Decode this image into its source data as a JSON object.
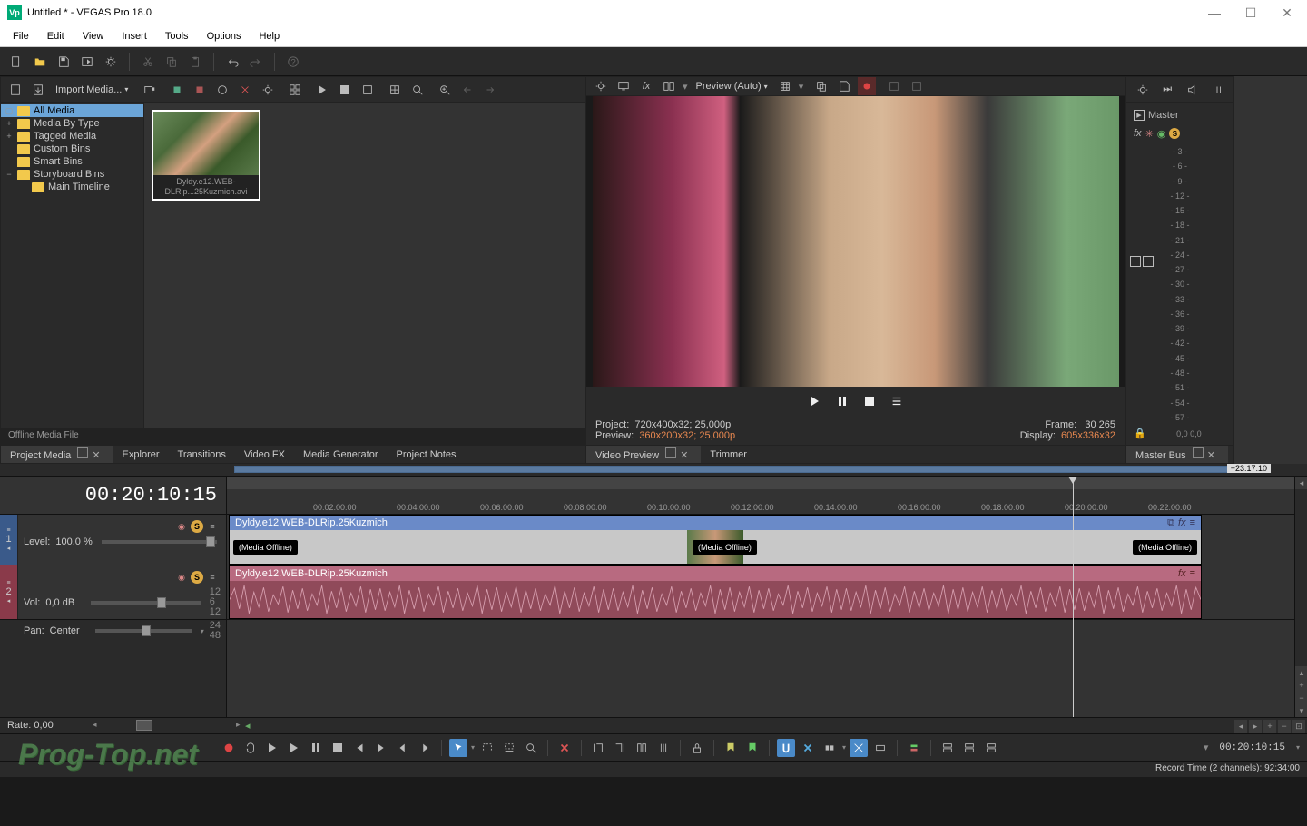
{
  "title": "Untitled * - VEGAS Pro 18.0",
  "menu": [
    "File",
    "Edit",
    "View",
    "Insert",
    "Tools",
    "Options",
    "Help"
  ],
  "projectMedia": {
    "importLabel": "Import Media...",
    "tree": [
      {
        "label": "All Media",
        "selected": true,
        "expand": "▢",
        "indent": 0
      },
      {
        "label": "Media By Type",
        "expand": "+",
        "indent": 0
      },
      {
        "label": "Tagged Media",
        "expand": "+",
        "indent": 0
      },
      {
        "label": "Custom Bins",
        "expand": "",
        "indent": 0
      },
      {
        "label": "Smart Bins",
        "expand": "",
        "indent": 0
      },
      {
        "label": "Storyboard Bins",
        "expand": "−",
        "indent": 0
      },
      {
        "label": "Main Timeline",
        "expand": "",
        "indent": 1
      }
    ],
    "thumbCaption": "Dyldy.e12.WEB-DLRip...25Kuzmich.avi",
    "status": "Offline Media File",
    "tabs": [
      "Project Media",
      "Explorer",
      "Transitions",
      "Video FX",
      "Media Generator",
      "Project Notes"
    ]
  },
  "preview": {
    "modeLabel": "Preview (Auto)",
    "projectLabel": "Project:",
    "projectValue": "720x400x32; 25,000p",
    "previewLabel": "Preview:",
    "previewValue": "360x200x32; 25,000p",
    "frameLabel": "Frame:",
    "frameValue": "30 265",
    "displayLabel": "Display:",
    "displayValue": "605x336x32",
    "tabs": [
      "Video Preview",
      "Trimmer"
    ]
  },
  "master": {
    "title": "Master",
    "scale": [
      "- 3 -",
      "- 6 -",
      "- 9 -",
      "- 12 -",
      "- 15 -",
      "- 18 -",
      "- 21 -",
      "- 24 -",
      "- 27 -",
      "- 30 -",
      "- 33 -",
      "- 36 -",
      "- 39 -",
      "- 42 -",
      "- 45 -",
      "- 48 -",
      "- 51 -",
      "- 54 -",
      "- 57 -"
    ],
    "footer": "0,0         0,0",
    "tab": "Master Bus"
  },
  "timeline": {
    "timecode": "00:20:10:15",
    "loopEnd": "+23:17:10",
    "ruler": [
      "00:02:00:00",
      "00:04:00:00",
      "00:06:00:00",
      "00:08:00:00",
      "00:10:00:00",
      "00:12:00:00",
      "00:14:00:00",
      "00:16:00:00",
      "00:18:00:00",
      "00:20:00:00",
      "00:22:00:00"
    ],
    "track1": {
      "levelLabel": "Level:",
      "levelValue": "100,0 %",
      "clipName": "Dyldy.e12.WEB-DLRip.25Kuzmich",
      "offline": "(Media Offline)"
    },
    "track2": {
      "volLabel": "Vol:",
      "volValue": "0,0 dB",
      "panLabel": "Pan:",
      "panValue": "Center",
      "meterLabels": [
        "12",
        "6",
        "12",
        "24",
        "48"
      ],
      "clipName": "Dyldy.e12.WEB-DLRip.25Kuzmich"
    },
    "rate": "Rate: 0,00",
    "tcSmall": "00:20:10:15"
  },
  "recordTime": "Record Time (2 channels): 92:34:00",
  "watermark": "Prog-Top.net"
}
